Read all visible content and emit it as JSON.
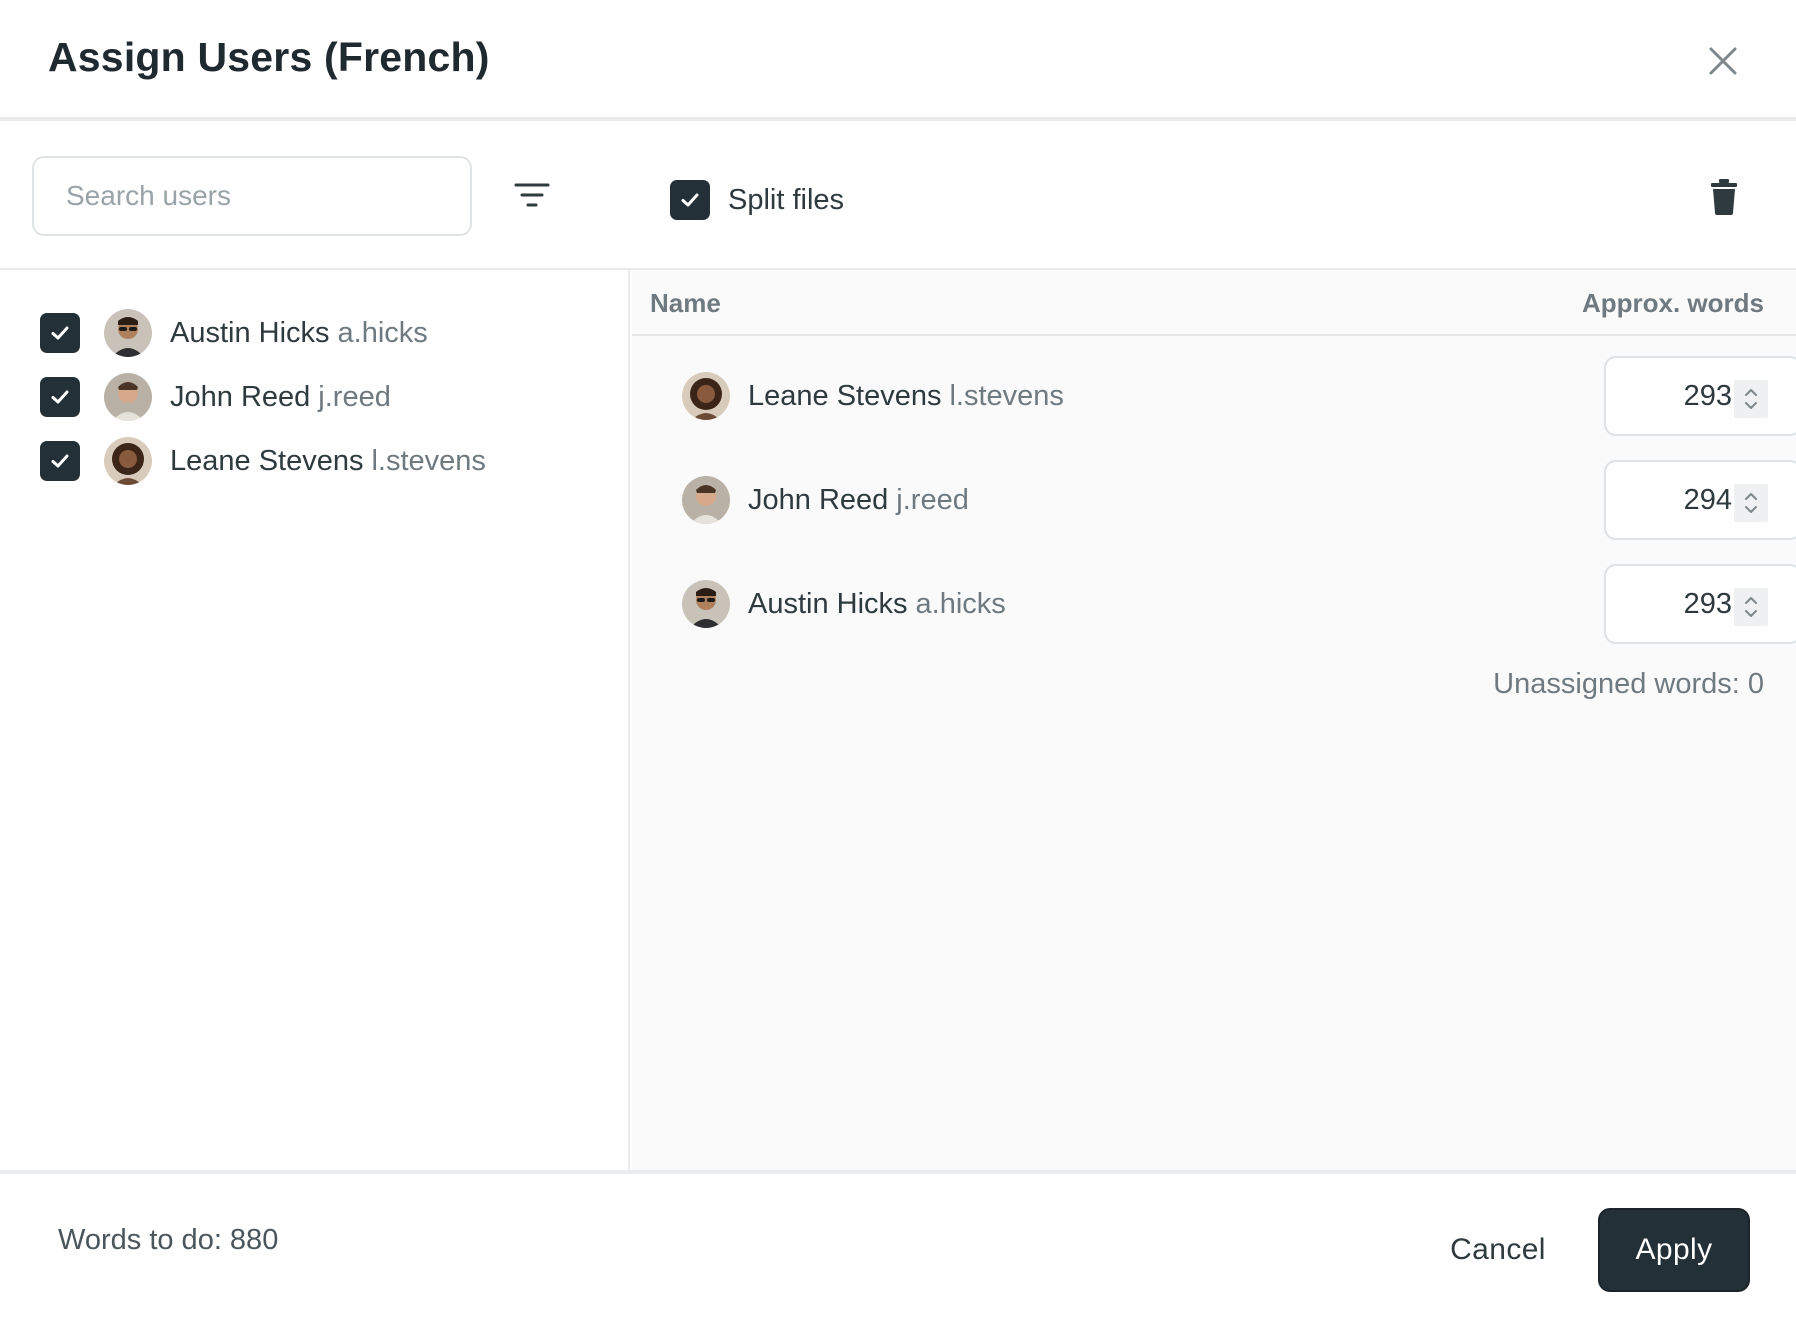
{
  "dialog": {
    "title": "Assign Users (French)"
  },
  "toolbar": {
    "search_placeholder": "Search users",
    "split_files_label": "Split files",
    "split_files_checked": true
  },
  "user_list": [
    {
      "name": "Austin Hicks",
      "handle": "a.hicks",
      "checked": true
    },
    {
      "name": "John Reed",
      "handle": "j.reed",
      "checked": true
    },
    {
      "name": "Leane Stevens",
      "handle": "l.stevens",
      "checked": true
    }
  ],
  "assignment_table": {
    "col_name": "Name",
    "col_words": "Approx. words",
    "rows": [
      {
        "name": "Leane Stevens",
        "handle": "l.stevens",
        "words": "293"
      },
      {
        "name": "John Reed",
        "handle": "j.reed",
        "words": "294"
      },
      {
        "name": "Austin Hicks",
        "handle": "a.hicks",
        "words": "293"
      }
    ],
    "unassigned": "Unassigned words: 0"
  },
  "footer": {
    "words_to_do": "Words to do: 880",
    "cancel_label": "Cancel",
    "apply_label": "Apply"
  },
  "colors": {
    "accent": "#243038",
    "muted_text": "#6f7a80",
    "border": "#dfe2e4"
  }
}
